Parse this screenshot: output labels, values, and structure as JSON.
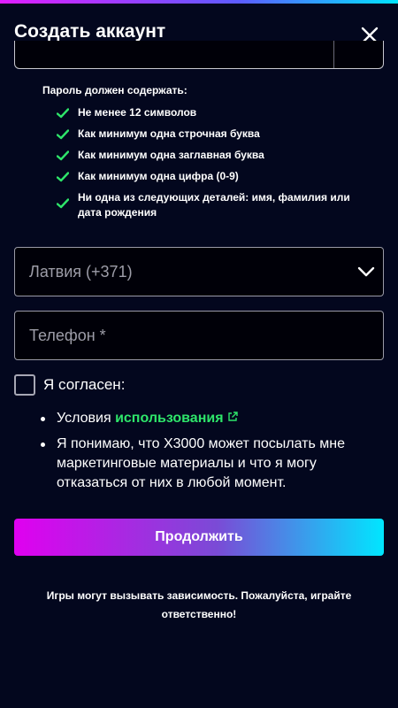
{
  "header": {
    "title": "Создать аккаунт",
    "close_icon": "close-icon"
  },
  "password_rules": {
    "title": "Пароль должен содержать:",
    "items": [
      {
        "label": "Не менее 12 символов",
        "met": true
      },
      {
        "label": "Как минимум одна строчная буква",
        "met": true
      },
      {
        "label": "Как минимум одна заглавная буква",
        "met": true
      },
      {
        "label": "Как минимум одна цифра (0-9)",
        "met": true
      },
      {
        "label": "Ни одна из следующих деталей: имя, фамилия или дата рождения",
        "met": true
      }
    ]
  },
  "country_select": {
    "value": "Латвия (+371)",
    "icon": "chevron-down-icon"
  },
  "phone_input": {
    "placeholder": "Телефон *"
  },
  "agreement": {
    "label": "Я согласен:",
    "checked": false,
    "terms_prefix": "Условия ",
    "terms_link": "использования",
    "terms_icon": "external-link-icon",
    "marketing": "Я понимаю, что X3000 может посылать мне маркетинговые материалы и что я могу отказаться от них в любой момент."
  },
  "continue_button": {
    "label": "Продолжить"
  },
  "disclaimer": "Игры могут вызывать зависимость. Пожалуйста, играйте ответственно!",
  "colors": {
    "background": "#03071e",
    "check_green": "#2ee56a",
    "link_green": "#2ee56a",
    "gradient_start": "#e000f0",
    "gradient_end": "#00e6ff"
  }
}
